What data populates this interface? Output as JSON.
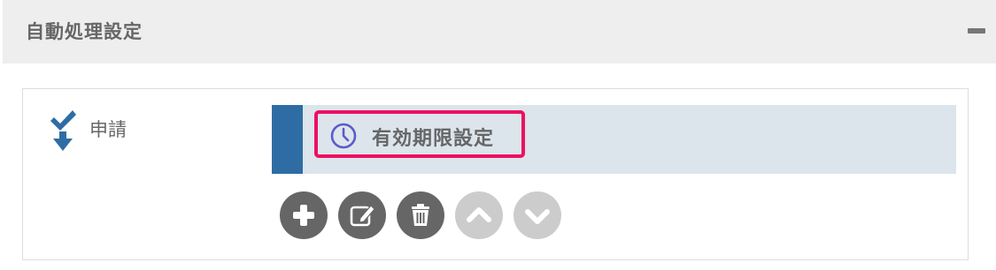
{
  "panel": {
    "title": "自動処理設定"
  },
  "step": {
    "label": "申請"
  },
  "process_items": [
    {
      "label": "有効期限設定",
      "icon": "clock-icon",
      "selected": true
    }
  ],
  "actions": [
    {
      "name": "add-button",
      "icon": "plus-icon",
      "enabled": true
    },
    {
      "name": "edit-button",
      "icon": "edit-icon",
      "enabled": true
    },
    {
      "name": "delete-button",
      "icon": "trash-icon",
      "enabled": true
    },
    {
      "name": "move-up-button",
      "icon": "chevron-up-icon",
      "enabled": false
    },
    {
      "name": "move-down-button",
      "icon": "chevron-down-icon",
      "enabled": false
    }
  ],
  "colors": {
    "accent_bar": "#2e6da4",
    "selection_border": "#ee0f63",
    "clock_icon": "#5b5bc8",
    "step_icon": "#2e6da4",
    "button_enabled": "#666666",
    "button_disabled": "#cccccc"
  }
}
